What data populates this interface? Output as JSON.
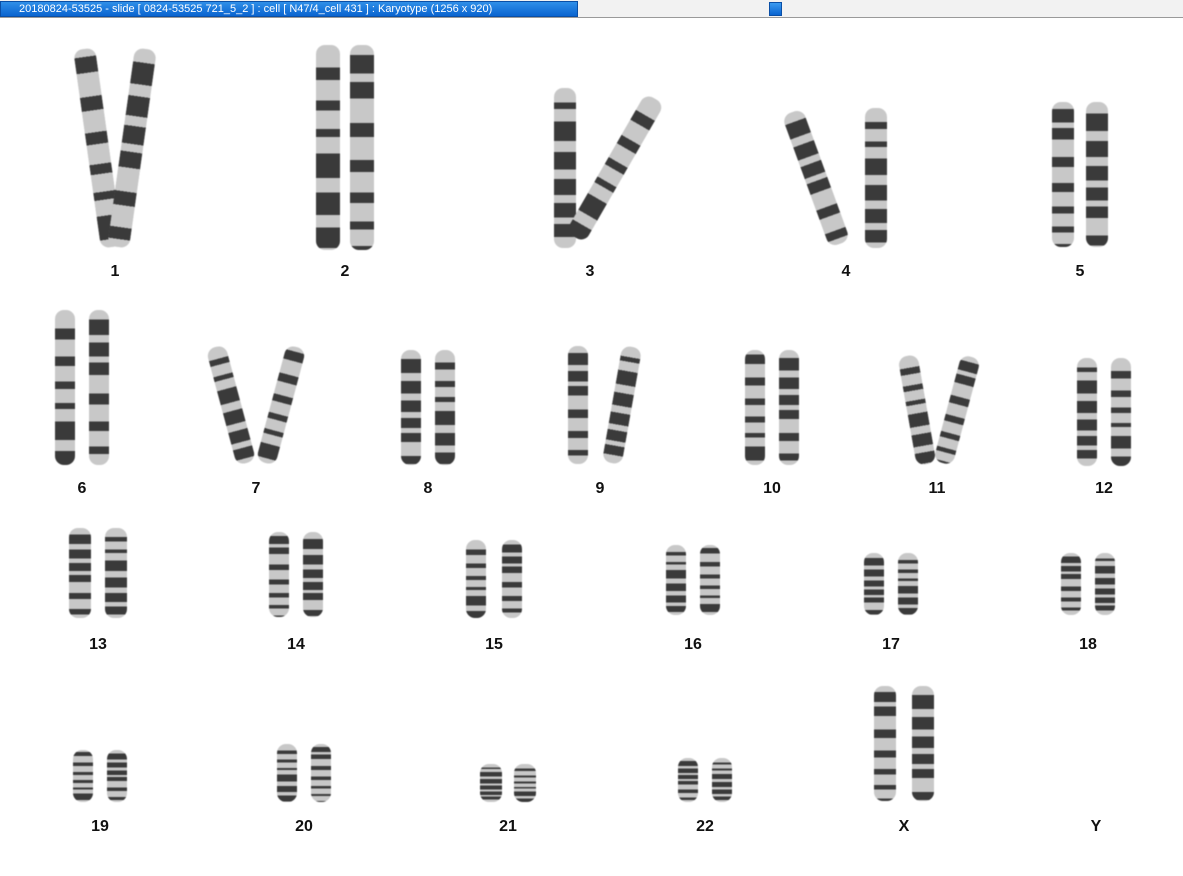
{
  "window": {
    "title": "20180824-53525 - slide [ 0824-53525 721_5_2 ] : cell [ N47/4_cell 431 ] : Karyotype  (1256 x 920)"
  },
  "colors": {
    "title_bar": "#0a64d0",
    "title_text": "#ffffff",
    "chromosome_light": "#c8c8c8",
    "chromosome_band": "#3a3a3a"
  },
  "karyotype": {
    "chromosomes": [
      {
        "label": "1"
      },
      {
        "label": "2"
      },
      {
        "label": "3"
      },
      {
        "label": "4"
      },
      {
        "label": "5"
      },
      {
        "label": "6"
      },
      {
        "label": "7"
      },
      {
        "label": "8"
      },
      {
        "label": "9"
      },
      {
        "label": "10"
      },
      {
        "label": "11"
      },
      {
        "label": "12"
      },
      {
        "label": "13"
      },
      {
        "label": "14"
      },
      {
        "label": "15"
      },
      {
        "label": "16"
      },
      {
        "label": "17"
      },
      {
        "label": "18"
      },
      {
        "label": "19"
      },
      {
        "label": "20"
      },
      {
        "label": "21"
      },
      {
        "label": "22"
      },
      {
        "label": "X"
      },
      {
        "label": "Y"
      }
    ]
  }
}
